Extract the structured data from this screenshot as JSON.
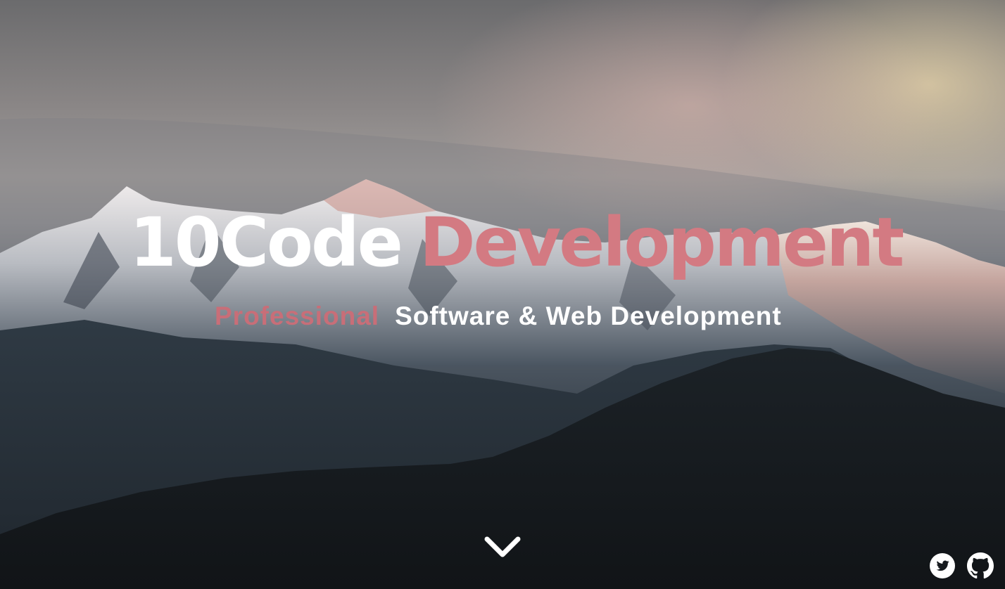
{
  "hero": {
    "title_word_1": "10Code",
    "title_word_2": "Development",
    "subtitle_word_1": "Professional",
    "subtitle_rest": "Software & Web Development"
  },
  "icons": {
    "scroll": "chevron-down-icon",
    "twitter": "twitter-icon",
    "github": "github-icon"
  },
  "colors": {
    "accent": "#d37a82",
    "text": "#ffffff"
  }
}
